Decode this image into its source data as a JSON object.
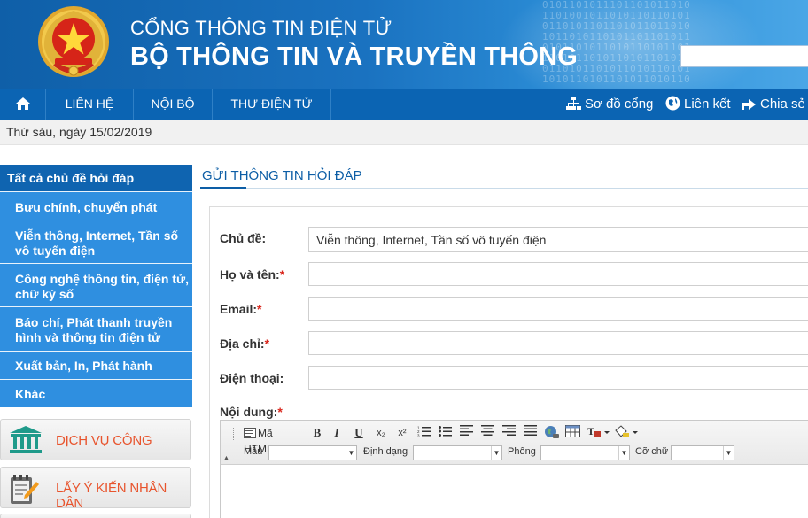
{
  "header": {
    "title_line1": "CỔNG THÔNG TIN ĐIỆN TỬ",
    "title_line2": "BỘ THÔNG TIN VÀ TRUYỀN THÔNG",
    "binary_pattern": "0101101011101101011010\n1101001011010110110101\n0110101101101011011010\n1011010110101101101011\n0101101011010110101101\n1101011010110101101010\n0110101101011010110101\n1010110101101011010110",
    "emblem_icon": "national-emblem-icon",
    "search": {
      "placeholder": "",
      "value": ""
    },
    "banner_color": "#1a72c0"
  },
  "nav": {
    "home_icon": "home-icon",
    "items": [
      {
        "label": "LIÊN HỆ"
      },
      {
        "label": "NỘI BỘ"
      },
      {
        "label": "THƯ ĐIỆN TỬ"
      }
    ],
    "right": [
      {
        "label": "Sơ đồ cổng",
        "icon": "sitemap-icon"
      },
      {
        "label": "Liên kết",
        "icon": "globe-icon"
      },
      {
        "label": "Chia sẻ",
        "icon": "share-icon"
      }
    ],
    "color": "#0b64b3"
  },
  "date_text": "Thứ sáu, ngày 15/02/2019",
  "sidebar": {
    "topics": [
      {
        "label": "Tất cả chủ đề hỏi đáp"
      },
      {
        "label": "Bưu chính, chuyển phát"
      },
      {
        "label": "Viễn thông, Internet, Tần số vô tuyến điện"
      },
      {
        "label": "Công nghệ thông tin, điện tử, chữ ký số"
      },
      {
        "label": "Báo chí, Phát thanh truyền hình và thông tin điện tử"
      },
      {
        "label": "Xuất bản, In, Phát hành"
      },
      {
        "label": "Khác"
      }
    ],
    "services": [
      {
        "label": "DỊCH VỤ CÔNG",
        "icon": "public-building-icon"
      },
      {
        "label": "LẤY Ý KIẾN NHÂN DÂN",
        "icon": "notepad-pen-icon"
      }
    ],
    "accent": "#2f8fe0"
  },
  "form": {
    "section_title": "GỬI THÔNG TIN HỎI ĐÁP",
    "fields": {
      "subject": {
        "label": "Chủ đề:",
        "value": "Viễn thông, Internet, Tần số vô tuyến điện"
      },
      "name": {
        "label": "Họ và tên:",
        "required": "*",
        "value": ""
      },
      "email": {
        "label": "Email:",
        "required": "*",
        "value": ""
      },
      "address": {
        "label": "Địa chỉ:",
        "required": "*",
        "value": ""
      },
      "phone": {
        "label": "Điện thoại:",
        "value": ""
      },
      "content": {
        "label": "Nội dung:",
        "required": "*"
      }
    },
    "editor": {
      "source_label": "Mã HTML",
      "bold": "B",
      "italic": "I",
      "underline": "U",
      "subscript": "x₂",
      "superscript": "x²",
      "style_label": "Mẫu",
      "format_label": "Định dạng",
      "font_label": "Phông",
      "size_label": "Cỡ chữ",
      "collapse": "▲"
    }
  }
}
